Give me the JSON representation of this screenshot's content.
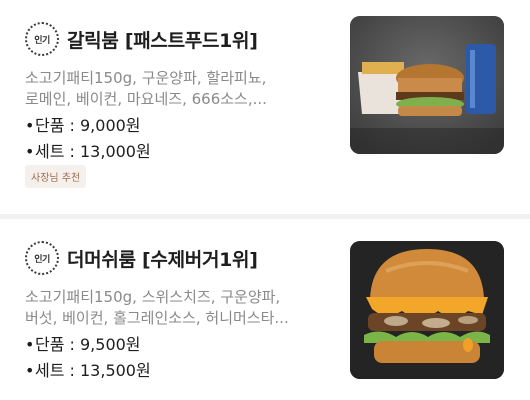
{
  "menu": {
    "items": [
      {
        "icon": "popular-badge-icon",
        "icon_text": "인기",
        "title": "갈릭붐 [패스트푸드1위]",
        "description_lines": [
          "소고기패티150g, 구운양파, 할라피뇨,",
          "로메인, 베이컨, 마요네즈, 666소스,..."
        ],
        "prices": [
          {
            "bullet": "•",
            "label": "단품 : 9,000원"
          },
          {
            "bullet": "•",
            "label": "세트 : 13,000원"
          }
        ],
        "badge": "사장님 추천",
        "image": "garlic-boom-burger-set-photo"
      },
      {
        "icon": "popular-badge-icon",
        "icon_text": "인기",
        "title": "더머쉬룸 [수제버거1위]",
        "description_lines": [
          "소고기패티150g, 스위스치즈, 구운양파,",
          "버섯, 베이컨, 홀그레인소스, 허니머스타..."
        ],
        "prices": [
          {
            "bullet": "•",
            "label": "단품 : 9,500원"
          },
          {
            "bullet": "•",
            "label": "세트 : 13,500원"
          }
        ],
        "image": "the-mushroom-burger-photo"
      }
    ]
  },
  "colors": {
    "title": "#1e1e1e",
    "description": "#8a8a8a",
    "badge_bg": "#f6f0ec",
    "badge_text": "#9a6f55",
    "divider": "#f1f1f1"
  }
}
